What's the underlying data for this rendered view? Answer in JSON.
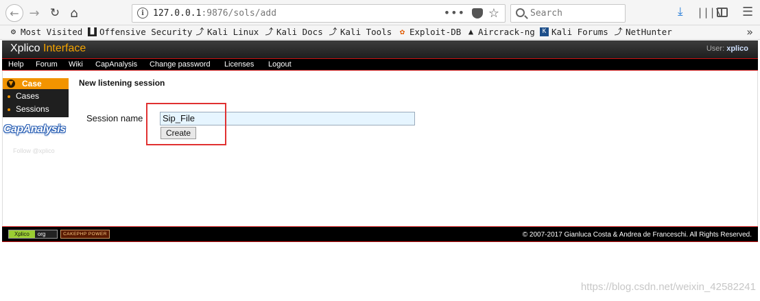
{
  "browser": {
    "url_host": "127.0.0.1",
    "url_rest": ":9876/sols/add",
    "search_placeholder": "Search",
    "bookmarks": [
      {
        "label": "Most Visited",
        "icon": "gear-icon"
      },
      {
        "label": "Offensive Security",
        "icon": "offsec-icon"
      },
      {
        "label": "Kali Linux",
        "icon": "kali-dragon-icon"
      },
      {
        "label": "Kali Docs",
        "icon": "kali-dragon-icon"
      },
      {
        "label": "Kali Tools",
        "icon": "kali-dragon-icon"
      },
      {
        "label": "Exploit-DB",
        "icon": "exploitdb-icon"
      },
      {
        "label": "Aircrack-ng",
        "icon": "aircrack-icon"
      },
      {
        "label": "Kali Forums",
        "icon": "kali-forums-icon"
      },
      {
        "label": "NetHunter",
        "icon": "kali-dragon-icon"
      }
    ]
  },
  "header": {
    "logo_main": "Xplico",
    "logo_accent": "Interface",
    "user_label": "User:",
    "user_name": "xplico"
  },
  "nav": [
    "Help",
    "Forum",
    "Wiki",
    "CapAnalysis",
    "Change password",
    "Licenses",
    "Logout"
  ],
  "sidebar": {
    "head": "Case",
    "items": [
      "Cases",
      "Sessions"
    ],
    "cap_logo": "CapAnalysis",
    "follow": "Follow @xplico"
  },
  "main": {
    "title": "New listening session",
    "field_label": "Session name",
    "field_value": "Sip_File",
    "button_label": "Create"
  },
  "footer": {
    "badge_xplico": "Xplico",
    "badge_org": "org",
    "badge_cake": "CAKEPHP POWER",
    "copyright": "© 2007-2017 Gianluca Costa & Andrea de Franceschi. All Rights Reserved."
  },
  "watermark": "https://blog.csdn.net/weixin_42582241",
  "colors": {
    "accent": "#f29400",
    "highlight": "#e03030",
    "nav_border": "#cc1111"
  }
}
